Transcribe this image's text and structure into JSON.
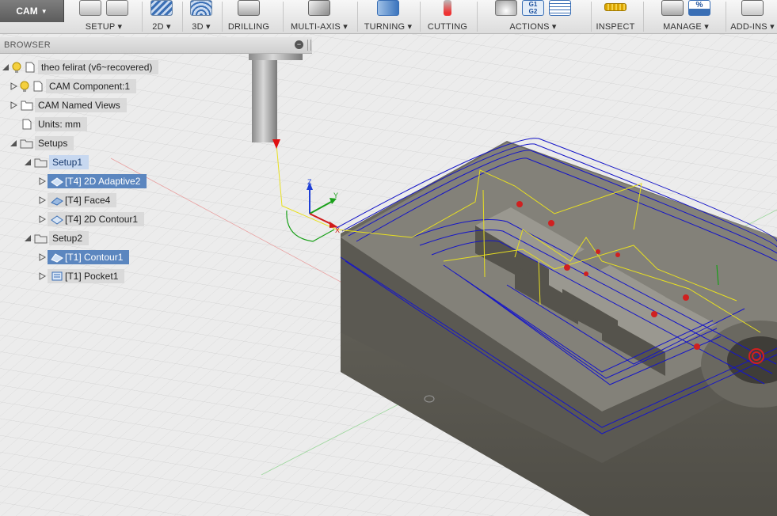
{
  "workspace": {
    "label": "CAM"
  },
  "toolbar": {
    "groups": [
      {
        "label": "SETUP"
      },
      {
        "label": "2D"
      },
      {
        "label": "3D"
      },
      {
        "label": "DRILLING"
      },
      {
        "label": "MULTI-AXIS"
      },
      {
        "label": "TURNING"
      },
      {
        "label": "CUTTING"
      },
      {
        "label": "ACTIONS"
      },
      {
        "label": "INSPECT"
      },
      {
        "label": "MANAGE"
      },
      {
        "label": "ADD-INS"
      }
    ],
    "icon_text": {
      "g1g2": "G1\nG2",
      "percent": "%"
    }
  },
  "browser": {
    "title": "BROWSER",
    "root": {
      "label": "theo felirat (v6~recovered)"
    },
    "component": {
      "label": "CAM Component:1"
    },
    "named_views": {
      "label": "CAM Named Views"
    },
    "units": {
      "label": "Units: mm"
    },
    "setups": {
      "label": "Setups"
    },
    "setup1": {
      "label": "Setup1"
    },
    "setup1_ops": [
      {
        "label": "[T4] 2D Adaptive2",
        "icon": "adaptive-icon"
      },
      {
        "label": "[T4] Face4",
        "icon": "face-icon"
      },
      {
        "label": "[T4] 2D Contour1",
        "icon": "contour-icon"
      }
    ],
    "setup2": {
      "label": "Setup2"
    },
    "setup2_ops": [
      {
        "label": "[T1] Contour1",
        "icon": "contour-icon"
      },
      {
        "label": "[T1] Pocket1",
        "icon": "pocket-icon"
      }
    ]
  },
  "viewport": {
    "triad": {
      "x": "X",
      "y": "Y",
      "z": "Z"
    }
  },
  "colors": {
    "toolpath": "#1515c8",
    "rapid": "#e8e020",
    "lead": "#18a018",
    "stock": "#5f5d55",
    "selection": "#5b86bf"
  }
}
